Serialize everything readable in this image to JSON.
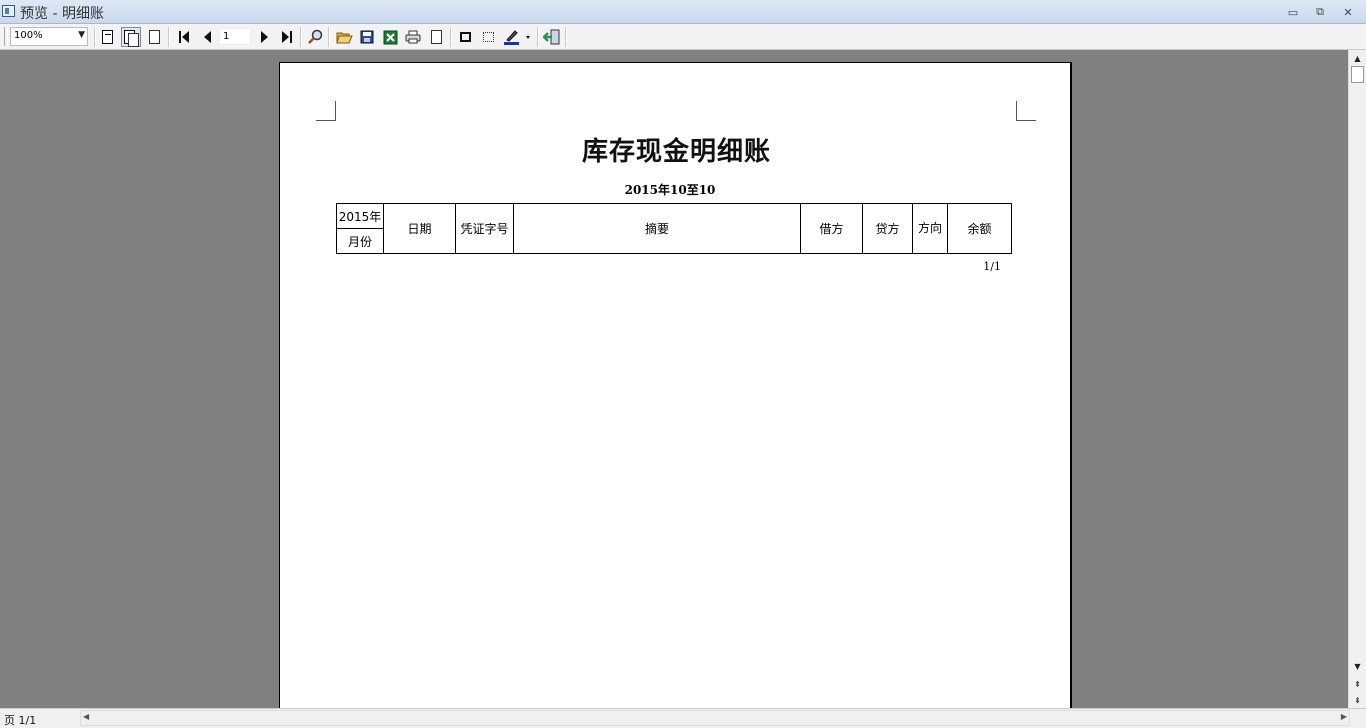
{
  "window": {
    "title": "预览 - 明细账",
    "minimize_glyph": "▭",
    "restore_glyph": "⧉",
    "close_glyph": "✕"
  },
  "toolbar": {
    "zoom_value": "100%",
    "page_number": "1",
    "icons": [
      "page-width-icon",
      "whole-page-icon",
      "single-page-icon",
      "first-page-icon",
      "prev-page-icon",
      "next-page-icon",
      "last-page-icon",
      "find-icon",
      "open-icon",
      "save-icon",
      "excel-export-icon",
      "print-icon",
      "blank-page-icon",
      "frame-icon",
      "dotted-frame-icon",
      "pen-color-icon",
      "exit-icon"
    ],
    "colors": {
      "excel": "#1f7a3a",
      "save": "#2a4f9a",
      "folder": "#e3b23c",
      "pen": "#1d2cc9",
      "exit": "#2e8f4e"
    }
  },
  "report": {
    "title": "库存现金明细账",
    "period": "2015年10至10",
    "table": {
      "year_header": "2015年",
      "month_header": "月份",
      "columns": [
        "日期",
        "凭证字号",
        "摘要",
        "借方",
        "贷方",
        "方向",
        "余额"
      ]
    },
    "page_count": "1/1"
  },
  "statusbar": {
    "page_label": "页 1/1"
  }
}
